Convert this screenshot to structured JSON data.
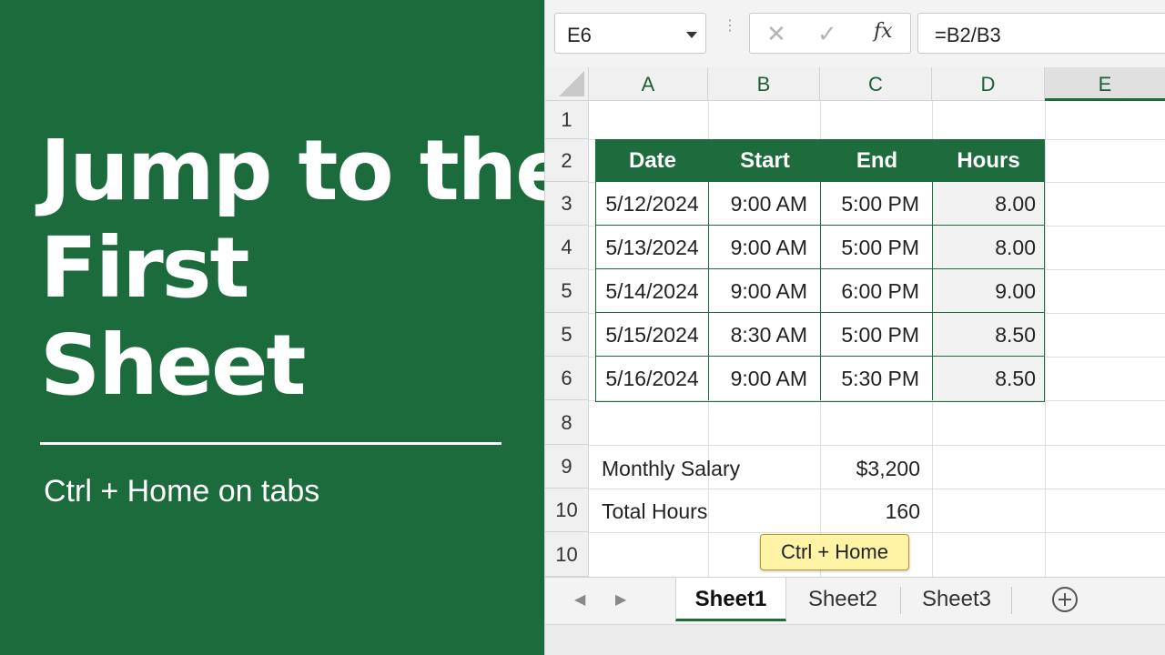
{
  "promo": {
    "title_lines": [
      "Jump to the",
      "First",
      "Sheet"
    ],
    "subtitle": "Ctrl + Home on tabs",
    "background": "#1b6b3d"
  },
  "formula_bar": {
    "name_box": "E6",
    "cancel_icon": "close-icon",
    "enter_icon": "check-icon",
    "fx_label": "fx",
    "formula": "=B2/B3"
  },
  "grid": {
    "columns": [
      "A",
      "B",
      "C",
      "D",
      "E"
    ],
    "selected_column": "E",
    "row_numbers": [
      "1",
      "2",
      "3",
      "4",
      "5",
      "5",
      "6",
      "8",
      "9",
      "10",
      "10"
    ]
  },
  "table": {
    "headers": [
      "Date",
      "Start",
      "End",
      "Hours"
    ],
    "rows": [
      [
        "5/12/2024",
        "9:00 AM",
        "5:00 PM",
        "8.00"
      ],
      [
        "5/13/2024",
        "9:00 AM",
        "5:00 PM",
        "8.00"
      ],
      [
        "5/14/2024",
        "9:00 AM",
        "6:00 PM",
        "9.00"
      ],
      [
        "5/15/2024",
        "8:30 AM",
        "5:00 PM",
        "8.50"
      ],
      [
        "5/16/2024",
        "9:00 AM",
        "5:30 PM",
        "8.50"
      ]
    ],
    "header_color": "#1e6b3e"
  },
  "summary": {
    "salary_label": "Monthly Salary",
    "salary_value": "$3,200",
    "hours_label": "Total Hours",
    "hours_value": "160"
  },
  "tooltip": "Ctrl + Home",
  "sheet_tabs": {
    "tabs": [
      "Sheet1",
      "Sheet2",
      "Sheet3"
    ],
    "active": "Sheet1",
    "prev_icon": "chevron-left-icon",
    "next_icon": "chevron-right-icon",
    "add_icon": "plus-circle-icon"
  }
}
